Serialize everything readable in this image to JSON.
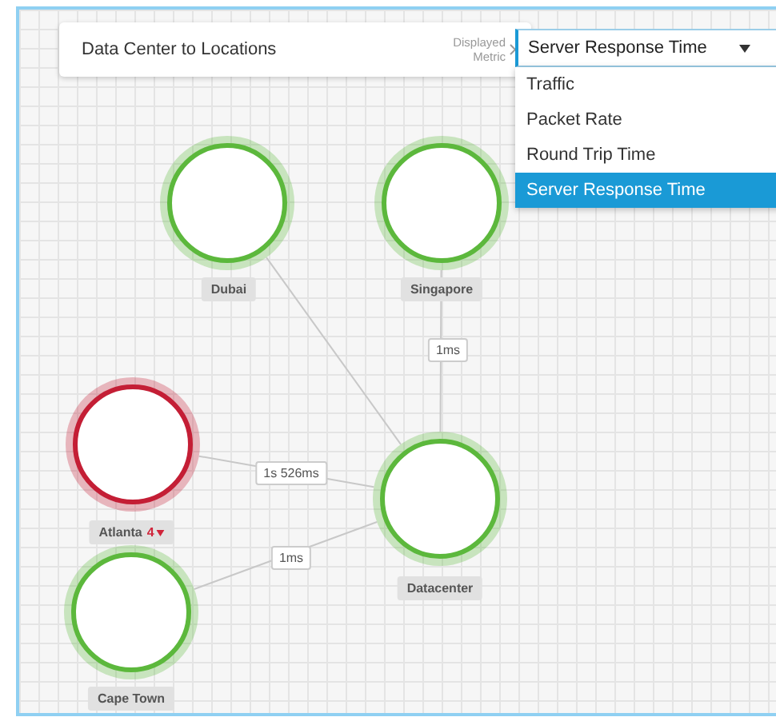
{
  "header": {
    "title": "Data Center to Locations",
    "metric_label": [
      "Displayed",
      "Metric"
    ],
    "metric": {
      "value": "Server Response Time",
      "expanded": true,
      "options": [
        {
          "label": "Traffic",
          "selected": false
        },
        {
          "label": "Packet Rate",
          "selected": false
        },
        {
          "label": "Round Trip Time",
          "selected": false
        },
        {
          "label": "Server Response Time",
          "selected": true
        }
      ]
    }
  },
  "nodes": [
    {
      "name": "Dubai",
      "color": "#5cb83c"
    },
    {
      "name": "Singapore",
      "color": "#5cb83c"
    },
    {
      "name": "Atlanta",
      "color": "#c41e35",
      "alert_count": "4"
    },
    {
      "name": "Datacenter",
      "color": "#5cb83c"
    },
    {
      "name": "Cape Town",
      "color": "#5cb83c"
    }
  ],
  "links": [
    {
      "kind": "plain"
    },
    {
      "kind": "labeled",
      "label": "1ms"
    },
    {
      "kind": "labeled",
      "label": "1s 526ms"
    },
    {
      "kind": "labeled",
      "label": "1ms"
    }
  ]
}
